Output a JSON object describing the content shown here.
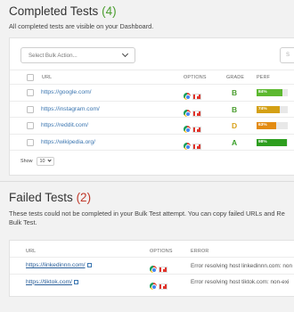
{
  "completed": {
    "title": "Completed Tests",
    "count": "(4)",
    "description": "All completed tests are visible on your Dashboard.",
    "bulk_action_placeholder": "Select Bulk Action...",
    "search_placeholder": "S",
    "columns": {
      "url": "URL",
      "options": "OPTIONS",
      "grade": "GRADE",
      "perf": "PERF"
    },
    "rows": [
      {
        "url": "https://google.com/",
        "grade": "B",
        "grade_color": "#4a9d2e",
        "perf": "84%",
        "perf_value": 84,
        "bar_color": "#5cb82f"
      },
      {
        "url": "https://instagram.com/",
        "grade": "B",
        "grade_color": "#4a9d2e",
        "perf": "74%",
        "perf_value": 74,
        "bar_color": "#d4a015"
      },
      {
        "url": "https://reddit.com/",
        "grade": "D",
        "grade_color": "#d9a21b",
        "perf": "63%",
        "perf_value": 63,
        "bar_color": "#e38b12"
      },
      {
        "url": "https://wikipedia.org/",
        "grade": "A",
        "grade_color": "#3aa02a",
        "perf": "98%",
        "perf_value": 98,
        "bar_color": "#2e9e1f"
      }
    ],
    "show_label": "Show",
    "show_value": "10"
  },
  "failed": {
    "title": "Failed Tests",
    "count": "(2)",
    "description_line1": "These tests could not be completed in your Bulk Test attempt. You can copy failed URLs and Re",
    "description_line2": "Bulk Test.",
    "columns": {
      "url": "URL",
      "options": "OPTIONS",
      "error": "ERROR"
    },
    "rows": [
      {
        "url": "https://linkedinnn.com/",
        "error": "Error resolving host linkedinnn.com: non"
      },
      {
        "url": "https://tiktok.com/",
        "error": "Error resolving host tiktok.com: non-exi"
      }
    ]
  }
}
